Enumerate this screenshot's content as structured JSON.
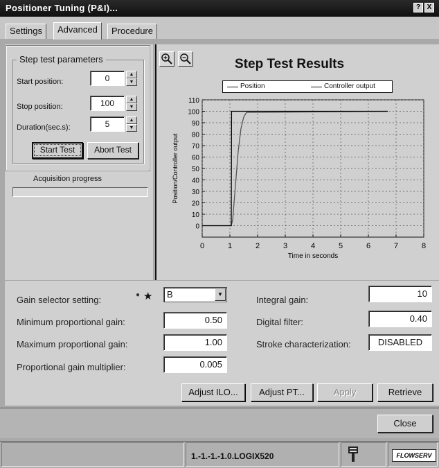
{
  "window": {
    "title": "Positioner Tuning (P&I)...",
    "help_button": "?",
    "close_button": "X"
  },
  "tabs": [
    {
      "label": "Settings",
      "active": false
    },
    {
      "label": "Advanced",
      "active": true
    },
    {
      "label": "Procedure",
      "active": false
    }
  ],
  "step_test": {
    "group_title": "Step test parameters",
    "start_label": "Start position:",
    "start_value": "0",
    "stop_label": "Stop position:",
    "stop_value": "100",
    "duration_label": "Duration(sec.s):",
    "duration_value": "5",
    "start_button": "Start Test",
    "abort_button": "Abort Test",
    "acquisition_label": "Acquisition progress",
    "acquisition_progress": 0.0
  },
  "chart_data": {
    "type": "line",
    "title": "Step Test Results",
    "xlabel": "Time in seconds",
    "ylabel": "Position/Controller output",
    "xlim": [
      0,
      8
    ],
    "ylim": [
      -10,
      110
    ],
    "xticks": [
      0,
      1,
      2,
      3,
      4,
      5,
      6,
      7,
      8
    ],
    "yticks": [
      0,
      10,
      20,
      30,
      40,
      50,
      60,
      70,
      80,
      90,
      100,
      110
    ],
    "grid": true,
    "legend_position": "top",
    "series": [
      {
        "name": "Position",
        "x": [
          0,
          1.05,
          1.1,
          1.2,
          1.3,
          1.4,
          1.5,
          1.6,
          6.7
        ],
        "y": [
          0,
          0,
          5,
          35,
          65,
          85,
          95,
          99,
          100
        ]
      },
      {
        "name": "Controller output",
        "x": [
          0,
          1.05,
          1.06,
          6.7
        ],
        "y": [
          0,
          0,
          100,
          100
        ]
      }
    ]
  },
  "tuning": {
    "gain_selector_label": "Gain selector setting:",
    "gain_selector_value": "B",
    "min_prop_label": "Minimum proportional gain:",
    "min_prop_value": "0.50",
    "max_prop_label": "Maximum proportional gain:",
    "max_prop_value": "1.00",
    "prop_mult_label": "Proportional gain multiplier:",
    "prop_mult_value": "0.005",
    "integral_label": "Integral gain:",
    "integral_value": "10",
    "digital_filter_label": "Digital filter:",
    "digital_filter_value": "0.40",
    "stroke_label": "Stroke characterization:",
    "stroke_value": "DISABLED"
  },
  "buttons": {
    "adjust_ilo": "Adjust ILO...",
    "adjust_pt": "Adjust PT...",
    "apply": "Apply",
    "retrieve": "Retrieve",
    "close": "Close"
  },
  "status": {
    "device": "1.-1.-1.-1.0.LOGIX520",
    "logo": "FLOWSERV"
  }
}
